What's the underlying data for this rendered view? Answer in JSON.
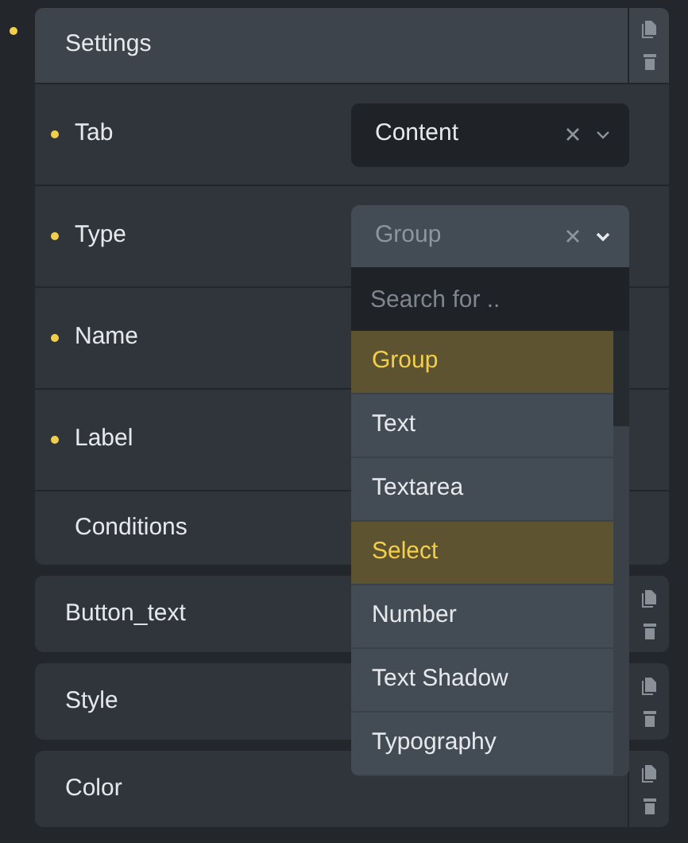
{
  "settings": {
    "title": "Settings",
    "modified": true
  },
  "fields": [
    {
      "label": "Tab",
      "modified": true,
      "kind": "select",
      "value": "Content",
      "open": false
    },
    {
      "label": "Type",
      "modified": true,
      "kind": "select",
      "value": "Group",
      "open": true
    },
    {
      "label": "Name",
      "modified": true,
      "kind": "empty"
    },
    {
      "label": "Label",
      "modified": true,
      "kind": "empty"
    },
    {
      "label": "Conditions",
      "modified": false,
      "kind": "empty"
    }
  ],
  "dropdown": {
    "placeholder": "Search for ..",
    "options": [
      {
        "label": "Group",
        "highlighted": true
      },
      {
        "label": "Text",
        "highlighted": false
      },
      {
        "label": "Textarea",
        "highlighted": false
      },
      {
        "label": "Select",
        "highlighted": true
      },
      {
        "label": "Number",
        "highlighted": false
      },
      {
        "label": "Text Shadow",
        "highlighted": false
      },
      {
        "label": "Typography",
        "highlighted": false
      }
    ]
  },
  "groups": [
    {
      "title": "Button_text"
    },
    {
      "title": "Style"
    },
    {
      "title": "Color"
    }
  ]
}
